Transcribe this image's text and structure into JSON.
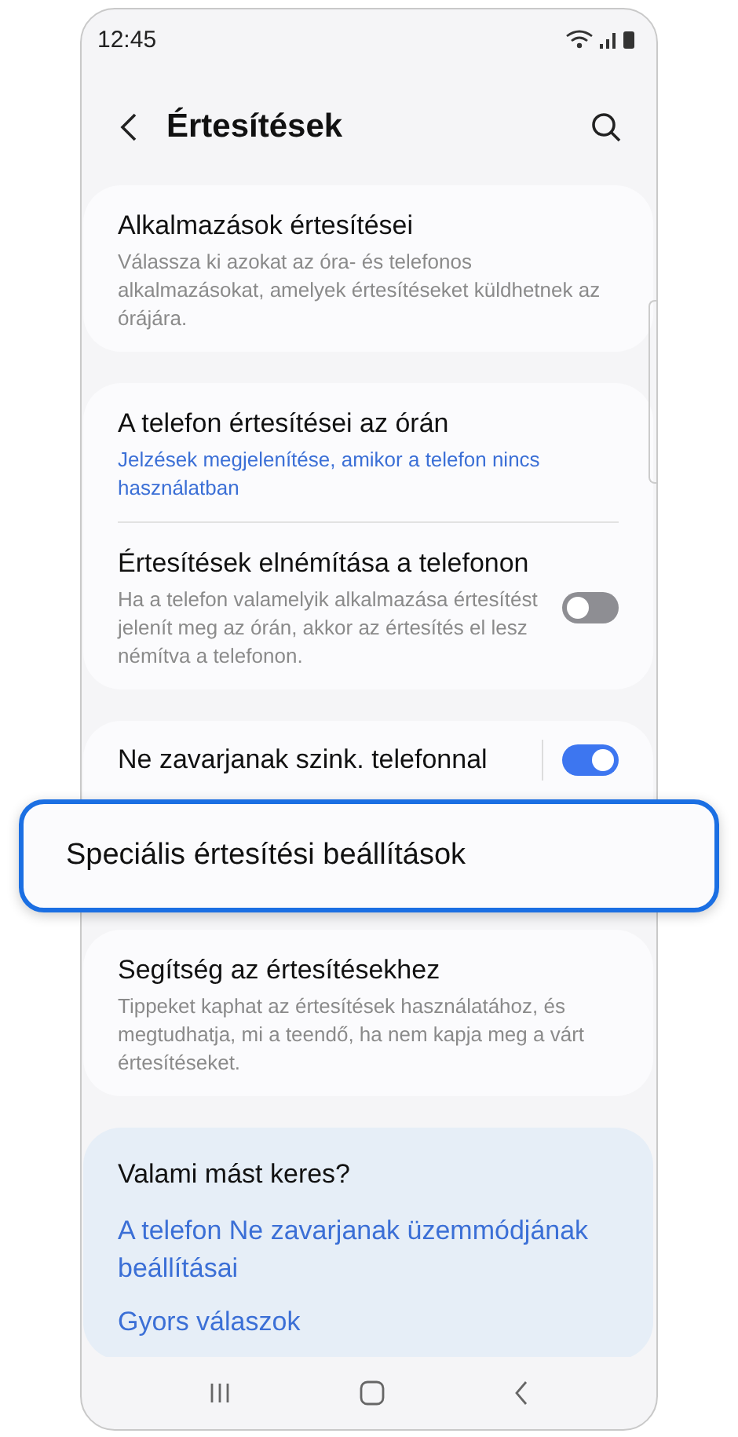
{
  "status_bar": {
    "time": "12:45"
  },
  "header": {
    "title": "Értesítések"
  },
  "groups": [
    {
      "items": [
        {
          "kind": "text",
          "title": "Alkalmazások értesítései",
          "subtitle": "Válassza ki azokat az óra- és telefonos alkalmazásokat, amelyek értesítéseket küldhetnek az órájára."
        }
      ]
    },
    {
      "items": [
        {
          "kind": "link",
          "title": "A telefon értesítései az órán",
          "subtitle": "Jelzések megjelenítése, amikor a telefon nincs használatban"
        },
        {
          "kind": "toggle",
          "title": "Értesítések elnémítása a telefonon",
          "subtitle": "Ha a telefon valamelyik alkalmazása értesítést jelenít meg az órán, akkor az értesítés el lesz némítva a telefonon.",
          "on": false
        }
      ]
    },
    {
      "items": [
        {
          "kind": "toggle",
          "title": "Ne zavarjanak szink. telefonnal",
          "on": true
        }
      ]
    },
    {
      "items": [
        {
          "kind": "text",
          "title": "Segítség az értesítésekhez",
          "subtitle": "Tippeket kaphat az értesítések használatához, és megtudhatja, mi a teendő, ha nem kapja meg a várt értesítéseket."
        }
      ]
    }
  ],
  "callout": {
    "title": "Speciális értesítési beállítások"
  },
  "related": {
    "heading": "Valami mást keres?",
    "links": [
      "A telefon Ne zavarjanak üzemmódjának beállításai",
      "Gyors válaszok"
    ]
  }
}
